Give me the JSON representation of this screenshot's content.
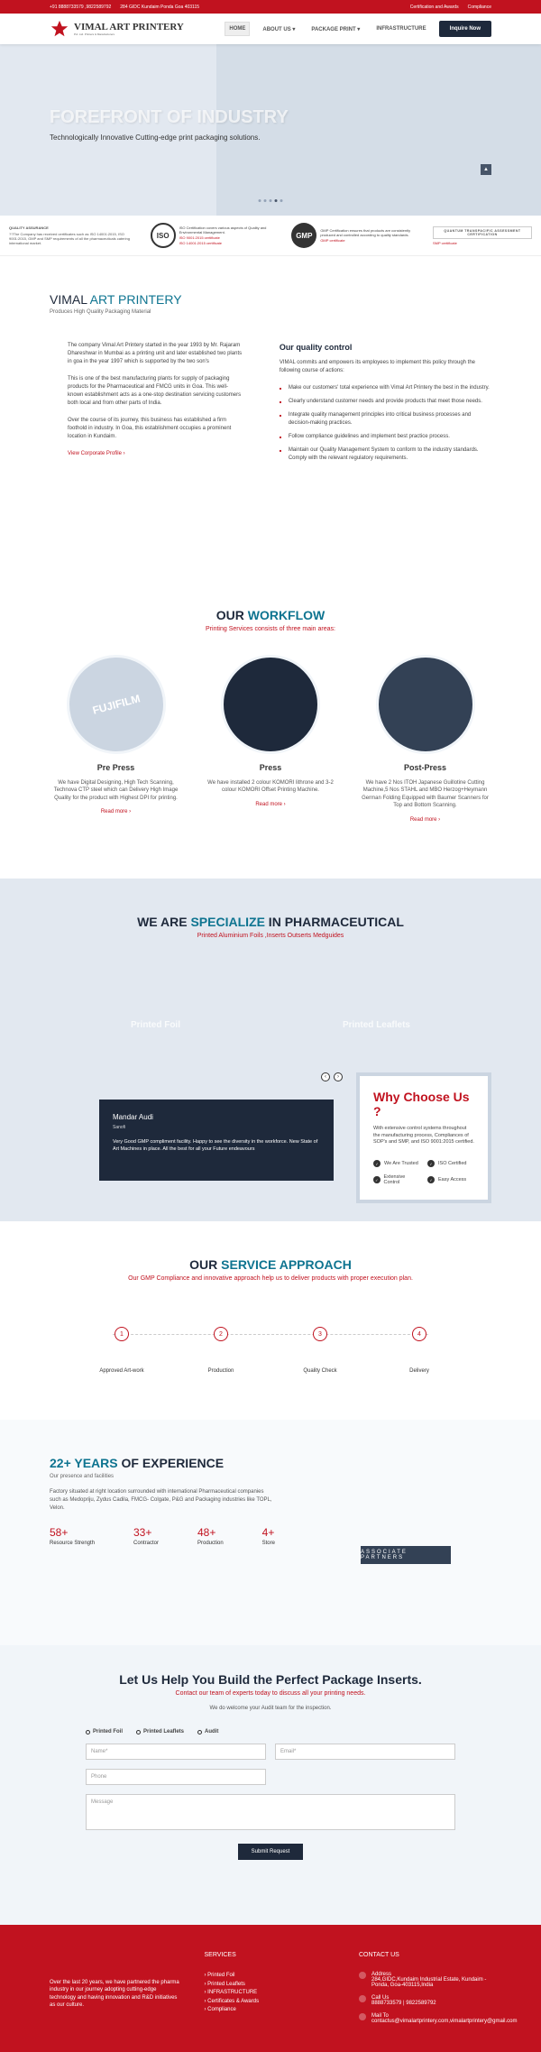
{
  "topbar": {
    "phone": "+91 8888733579 ,9822589792",
    "address": "284 GIDC Kundaim Ponda Goa 403115",
    "cert_link": "Certification and Awards",
    "compliance_link": "Compliance"
  },
  "header": {
    "logo_main": "VIMAL ART PRINTERY",
    "logo_sub": "Pvt. Ltd. Printers & Manufacturers",
    "nav": [
      "HOME",
      "ABOUT US",
      "PACKAGE PRINT",
      "INFRASTRUCTURE"
    ],
    "inquire": "Inquire Now"
  },
  "hero": {
    "title": "FOREFRONT OF INDUSTRY",
    "subtitle": "Technologically Innovative Cutting-edge print packaging solutions."
  },
  "certs": {
    "qa_title": "QUALITY ASSURANCE",
    "qa_desc": "??The Company has received certificates such as ISO 14001:2015, ISO 9001:2015, GMP and SMP requirements of all the pharmaceuticals catering international market.",
    "iso_desc": "ISO Certification covers various aspects of Quality and Environmental Management.",
    "iso_link1": "ISO 9001:2015 certificate",
    "iso_link2": "ISO 14001:2015 certificate",
    "gmp_desc": "GMP Certification ensures that products are consistently produced and controlled according to quality standards.",
    "gmp_link": "GMP certificate",
    "qt_text": "QUANTUM TRANSPACIFIC ASSESSMENT CERTIFICATION",
    "smp_link": "SMP certificate"
  },
  "about": {
    "title_dark": "VIMAL ",
    "title_highlight": "ART PRINTERY",
    "subtitle": "Produces High Quality Packaging Material",
    "p1": "The company Vimal Art Printery started in the year 1993 by Mr. Rajaram Dhareshwar in Mumbai as a printing unit and later established two plants in goa in the year 1997 which is supported by the two son's",
    "p2": "This is one of the best manufacturing plants for supply of packaging products for the Pharmaceutical and FMCG units in Goa. This well-known establishment acts as a one-stop destination servicing customers both local and from other parts of India.",
    "p3": "Over the course of its journey, this business has established a firm foothold in industry. In Goa, this establishment occupies a prominent location in Kundaim.",
    "link": "View Corporate Profile ›",
    "qc_title": "Our quality control",
    "qc_desc": "VIMAL commits and empowers its employees to implement this policy through the following course of actions:",
    "qc_list": [
      "Make our customers' total experience with Vimal Art Printery the best in the industry.",
      "Clearly understand customer needs and provide products that meet those needs.",
      "Integrate quality management principles into critical business processes and decision-making practices.",
      "Follow compliance guidelines and implement best practice process.",
      "Maintain our Quality Management System to conform to the industry standards. Comply with the relevant regulatory requirements."
    ]
  },
  "workflow": {
    "title_dark": "OUR ",
    "title_highlight": "WORKFLOW",
    "subtitle": "Printing Services consists of three main areas:",
    "items": [
      {
        "title": "Pre Press",
        "desc": "We have Digital Designing, High Tech Scanning, Technova CTP steel which can Delivery High Image Quality for the product with Highest DPI for printing.",
        "link": "Read more ›"
      },
      {
        "title": "Press",
        "desc": "We have installed 2 colour KOMORI lithrone and 3-2 colour KOMORI Offset Printing Machine.",
        "link": "Read more ›"
      },
      {
        "title": "Post-Press",
        "desc": "We have 2 Nos ITOH Japanese Guillotine Cutting Machine,5 Nos STAHL and MBO Herzog+Heymann German Folding Equipped with Baumer Scanners for Top and Bottom Scanning.",
        "link": "Read more ›"
      }
    ]
  },
  "specialize": {
    "title_dark": "WE ARE ",
    "title_highlight": "SPECIALIZE",
    "title_dark2": " IN PHARMACEUTICAL",
    "subtitle": "Printed Aluminium Foils ,Inserts Outserts Medguides",
    "item1": "Printed Foil",
    "item2": "Printed Leaflets"
  },
  "testimonial": {
    "name": "Mandar Audi",
    "company": "Sanofi",
    "text": "Very Good GMP compliment facility. Happy to see the diversity in the workforce. New State of Art Machines in place. All the best for all your Future endeavours"
  },
  "why_choose": {
    "title": "Why Choose Us ?",
    "desc": "With extensive control systems throughout the manufacturing process, Compliances of SOP's and SMP, and ISO 9001:2015 certified.",
    "features": [
      "We Are Trusted",
      "ISO Certified",
      "Extensive Control",
      "Easy Access"
    ]
  },
  "approach": {
    "title_dark": "OUR ",
    "title_highlight": "SERVICE APPROACH",
    "subtitle": "Our GMP Compliance and innovative approach help us to deliver products with proper execution plan.",
    "steps": [
      {
        "num": "1",
        "label": "Approved Art-work"
      },
      {
        "num": "2",
        "label": "Production"
      },
      {
        "num": "3",
        "label": "Quality Check"
      },
      {
        "num": "4",
        "label": "Delivery"
      }
    ]
  },
  "experience": {
    "title_highlight": "22+ YEARS",
    "title_dark": " OF EXPERIENCE",
    "subtitle": "Our presence and facilities",
    "desc": "Factory situated at right location surrounded with international Pharmaceutical companies such as Medopriju, Zydus Cadila, FMCG- Colgate, P&G and Packaging industries like TOPL, Velon.",
    "stats": [
      {
        "num": "58+",
        "label": "Resource Strength"
      },
      {
        "num": "33+",
        "label": "Contractor"
      },
      {
        "num": "48+",
        "label": "Production"
      },
      {
        "num": "4+",
        "label": "Store"
      }
    ],
    "partners": "ASSOCIATE PARTNERS"
  },
  "contact": {
    "title": "Let Us Help You Build the Perfect Package Inserts.",
    "subtitle": "Contact our team of experts today to discuss all your printing needs.",
    "desc": "We do welcome your Audit team for the inspection.",
    "tabs": [
      "Printed Foil",
      "Printed Leaflets",
      "Audit"
    ],
    "placeholders": {
      "name": "Name*",
      "email": "Email*",
      "phone": "Phone",
      "message": "Message"
    },
    "submit": "Submit Request"
  },
  "footer": {
    "desc": "Over the last 20 years, we have partnered the pharma industry in our journey adopting cutting-edge technology and having innovation and R&D initiatives as our culture.",
    "services_title": "SERVICES",
    "services": [
      "› Printed Foil",
      "› Printed Leaflets",
      "› INFRASTRUCTURE",
      "› Certificates & Awards",
      "› Compliance"
    ],
    "contact_title": "CONTACT US",
    "address_title": "Address",
    "address": "284,GIDC,Kundaim Industrial Estate, Kundaim - Ponda, Goa-403115,India",
    "call_title": "Call Us",
    "call": "8888733579 | 9822589792",
    "mail_title": "Mail To",
    "mail": "contactus@vimalartprintery.com,vimalartprintery@gmail.com"
  }
}
